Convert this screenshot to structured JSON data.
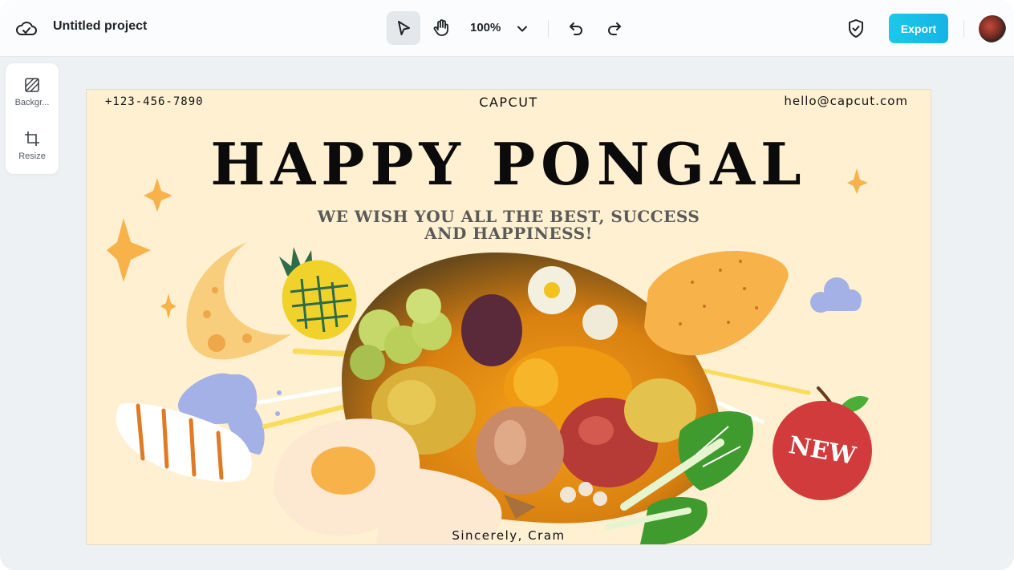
{
  "topbar": {
    "project_title": "Untitled project",
    "zoom_level": "100%",
    "export_label": "Export"
  },
  "sidepanel": {
    "items": [
      {
        "label": "Backgr...",
        "icon": "background-icon"
      },
      {
        "label": "Resize",
        "icon": "resize-icon"
      }
    ]
  },
  "canvas": {
    "phone": "+123-456-7890",
    "brand": "CAPCUT",
    "email": "hello@capcut.com",
    "headline": "HAPPY PONGAL",
    "subline_1": "WE WISH YOU ALL THE BEST, SUCCESS",
    "subline_2": "AND HAPPINESS!",
    "badge": "NEW",
    "signature": "Sincerely, Cram"
  },
  "colors": {
    "accent": "#14b4e6",
    "canvas_bg": "#fff0d1",
    "sticker_orange": "#f7b24a",
    "apple_red": "#d23b3b",
    "leaf_green": "#3f9b2e",
    "cloud_blue": "#a3b1e6"
  }
}
